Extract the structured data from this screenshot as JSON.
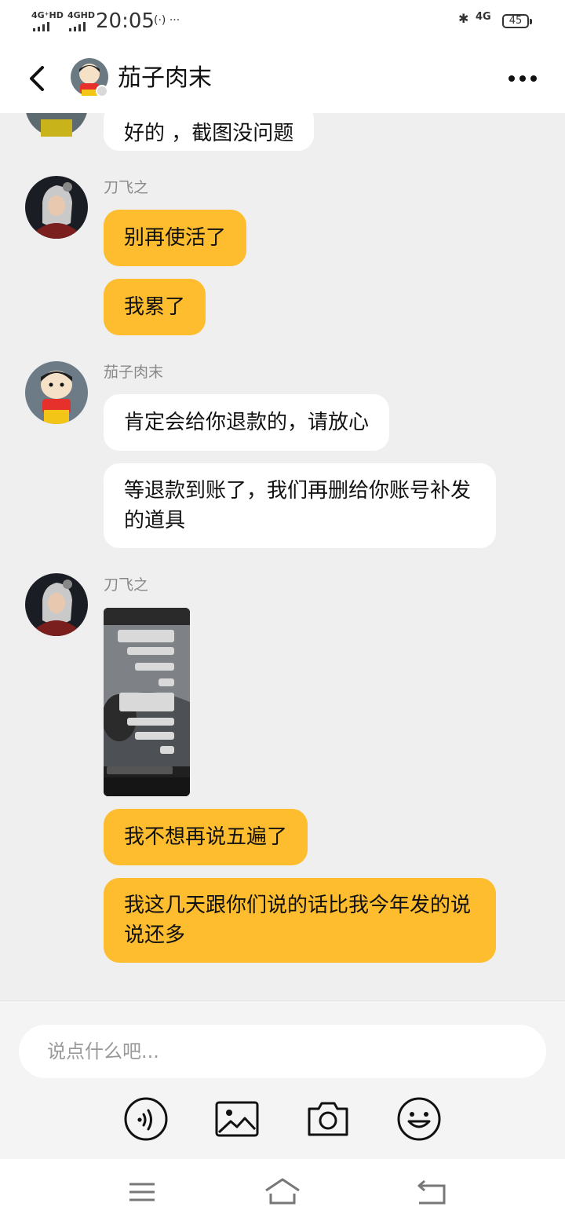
{
  "status_bar": {
    "signal_1": "4G⁺HD",
    "signal_2": "4GHD",
    "time": "20:05",
    "extra": "(·) ···",
    "network": "4G",
    "battery": "45"
  },
  "header": {
    "title": "茄子肉末"
  },
  "messages": [
    {
      "text": "好的 ，截图没问题"
    },
    {
      "sender": "刀飞之",
      "bubbles": [
        "别再使活了",
        "我累了"
      ]
    },
    {
      "sender": "茄子肉末",
      "bubbles": [
        "肯定会给你退款的，请放心",
        "等退款到账了，我们再删给你账号补发的道具"
      ]
    },
    {
      "sender": "刀飞之",
      "bubbles": [
        "我不想再说五遍了",
        "我这几天跟你们说的话比我今年发的说说还多"
      ]
    }
  ],
  "input": {
    "placeholder": "说点什么吧..."
  },
  "colors": {
    "accent_yellow": "#fdbd2e",
    "background": "#efefef"
  },
  "icons": [
    "back-icon",
    "more-icon",
    "voice-icon",
    "image-icon",
    "camera-icon",
    "emoji-icon",
    "menu-icon",
    "home-icon",
    "back-nav-icon"
  ]
}
